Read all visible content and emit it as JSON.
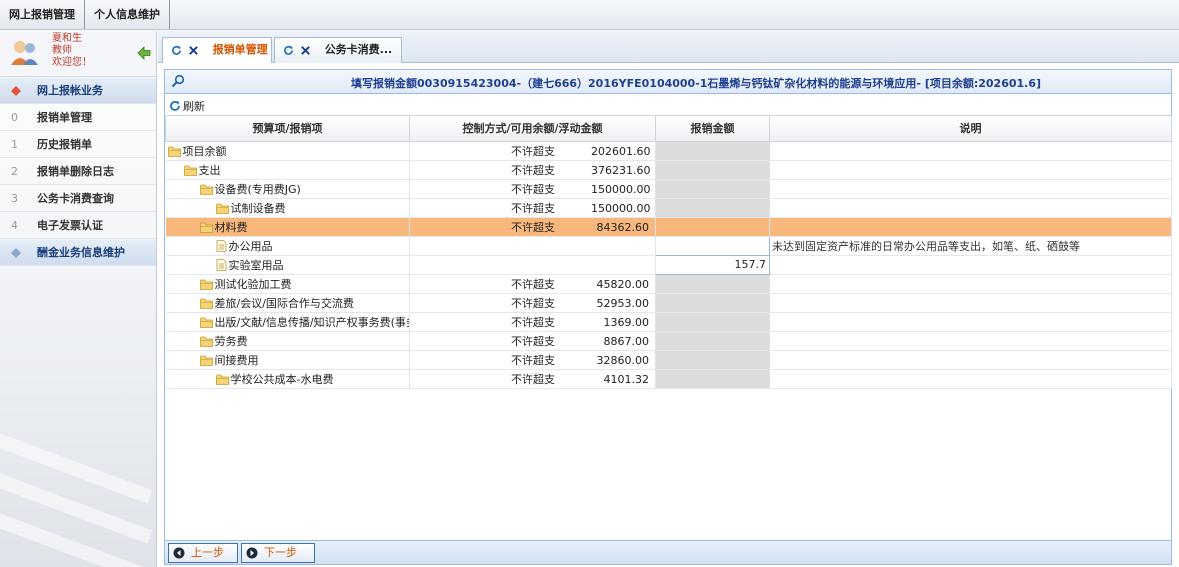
{
  "topmenu": {
    "items": [
      "网上报销管理",
      "个人信息维护"
    ]
  },
  "user": {
    "name": "夏和生",
    "role": "教师",
    "welcome": "欢迎您！"
  },
  "sidebar": {
    "section": "网上报帐业务",
    "items": [
      {
        "num": "0",
        "label": "报销单管理"
      },
      {
        "num": "1",
        "label": "历史报销单"
      },
      {
        "num": "2",
        "label": "报销单删除日志"
      },
      {
        "num": "3",
        "label": "公务卡消费查询"
      },
      {
        "num": "4",
        "label": "电子发票认证"
      }
    ],
    "extra": "酬金业务信息维护"
  },
  "tabs": [
    {
      "label": "报销单管理"
    },
    {
      "label": "公务卡消费..."
    }
  ],
  "panel": {
    "title": "填写报销金额0030915423004-（建七666）2016YFE0104000-1石墨烯与钙钛矿杂化材料的能源与环境应用- [项目余额:202601.6]",
    "refresh_label": "刷新",
    "columns": [
      "预算项/报销项",
      "控制方式/可用余额/浮动金额",
      "报销金额",
      "说明"
    ],
    "rows": [
      {
        "name": "项目余额",
        "level": 0,
        "icon": "folder",
        "mode": "不许超支",
        "amount": "202601.60",
        "claim": "",
        "note": ""
      },
      {
        "name": "支出",
        "level": 1,
        "icon": "folder",
        "mode": "不许超支",
        "amount": "376231.60",
        "claim": "",
        "note": ""
      },
      {
        "name": "设备费(专用费JG)",
        "level": 2,
        "icon": "folder",
        "mode": "不许超支",
        "amount": "150000.00",
        "claim": "",
        "note": ""
      },
      {
        "name": "试制设备费",
        "level": 3,
        "icon": "folder",
        "mode": "不许超支",
        "amount": "150000.00",
        "claim": "",
        "note": ""
      },
      {
        "name": "材料费",
        "level": 2,
        "icon": "folder",
        "mode": "不许超支",
        "amount": "84362.60",
        "claim": "",
        "note": "",
        "highlight": true
      },
      {
        "name": "办公用品",
        "level": 3,
        "icon": "doc",
        "mode": "",
        "amount": "",
        "claim": "",
        "note": "未达到固定资产标准的日常办公用品等支出，如笔、纸、硒鼓等",
        "editable": true
      },
      {
        "name": "实验室用品",
        "level": 3,
        "icon": "doc",
        "mode": "",
        "amount": "",
        "claim": "157.7",
        "note": "",
        "editable": true
      },
      {
        "name": "测试化验加工费",
        "level": 2,
        "icon": "folder",
        "mode": "不许超支",
        "amount": "45820.00",
        "claim": "",
        "note": ""
      },
      {
        "name": "差旅/会议/国际合作与交流费",
        "level": 2,
        "icon": "folder",
        "mode": "不许超支",
        "amount": "52953.00",
        "claim": "",
        "note": ""
      },
      {
        "name": "出版/文献/信息传播/知识产权事务费(事务费",
        "level": 2,
        "icon": "folder",
        "mode": "不许超支",
        "amount": "1369.00",
        "claim": "",
        "note": ""
      },
      {
        "name": "劳务费",
        "level": 2,
        "icon": "folder",
        "mode": "不许超支",
        "amount": "8867.00",
        "claim": "",
        "note": ""
      },
      {
        "name": "间接费用",
        "level": 2,
        "icon": "folder",
        "mode": "不许超支",
        "amount": "32860.00",
        "claim": "",
        "note": ""
      },
      {
        "name": "学校公共成本-水电费",
        "level": 3,
        "icon": "folder",
        "mode": "不许超支",
        "amount": "4101.32",
        "claim": "",
        "note": ""
      }
    ],
    "prev_label": "上一步",
    "next_label": "下一步"
  },
  "colors": {
    "highlight_row": "#f8b87c",
    "title_blue": "#1f3f8f",
    "active_tab": "#d35400"
  }
}
